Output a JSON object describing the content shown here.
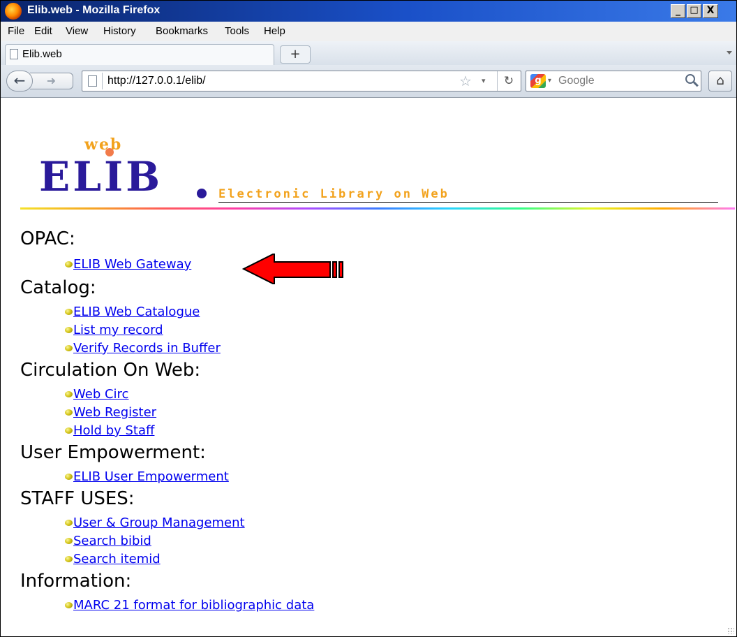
{
  "window": {
    "title": "Elib.web - Mozilla Firefox",
    "minimize_label": "_",
    "maximize_label": "□",
    "close_label": "X"
  },
  "menu": [
    "File",
    "Edit",
    "View",
    "History",
    "Bookmarks",
    "Tools",
    "Help"
  ],
  "tab": {
    "label": "Elib.web",
    "new_tab_label": "+"
  },
  "nav": {
    "url": "http://127.0.0.1/elib/",
    "search_placeholder": "Google",
    "back_icon": "back-arrow-icon",
    "forward_icon": "forward-arrow-icon",
    "reload_icon": "reload-icon",
    "home_icon": "home-icon",
    "bookmark_icon": "star-icon"
  },
  "logo": {
    "web_text": "web",
    "main_text": "ELIB",
    "subtitle": "Electronic Library on Web",
    "colors": {
      "main": "#2a1a9a",
      "accent": "#f2a21c"
    }
  },
  "sections": [
    {
      "title": "OPAC:",
      "links": [
        "ELIB Web Gateway"
      ]
    },
    {
      "title": "Catalog:",
      "links": [
        "ELIB Web Catalogue",
        "List my record",
        "Verify Records in Buffer"
      ]
    },
    {
      "title": "Circulation On Web:",
      "links": [
        "Web Circ",
        "Web Register",
        "Hold by Staff"
      ]
    },
    {
      "title": "User Empowerment:",
      "links": [
        "ELIB User Empowerment"
      ]
    },
    {
      "title": "STAFF USES:",
      "links": [
        "User & Group Management",
        "Search bibid",
        "Search itemid"
      ]
    },
    {
      "title": "Information:",
      "links": [
        "MARC 21 format for bibliographic data"
      ]
    }
  ],
  "annotation": {
    "arrow_color": "#ff0000"
  }
}
